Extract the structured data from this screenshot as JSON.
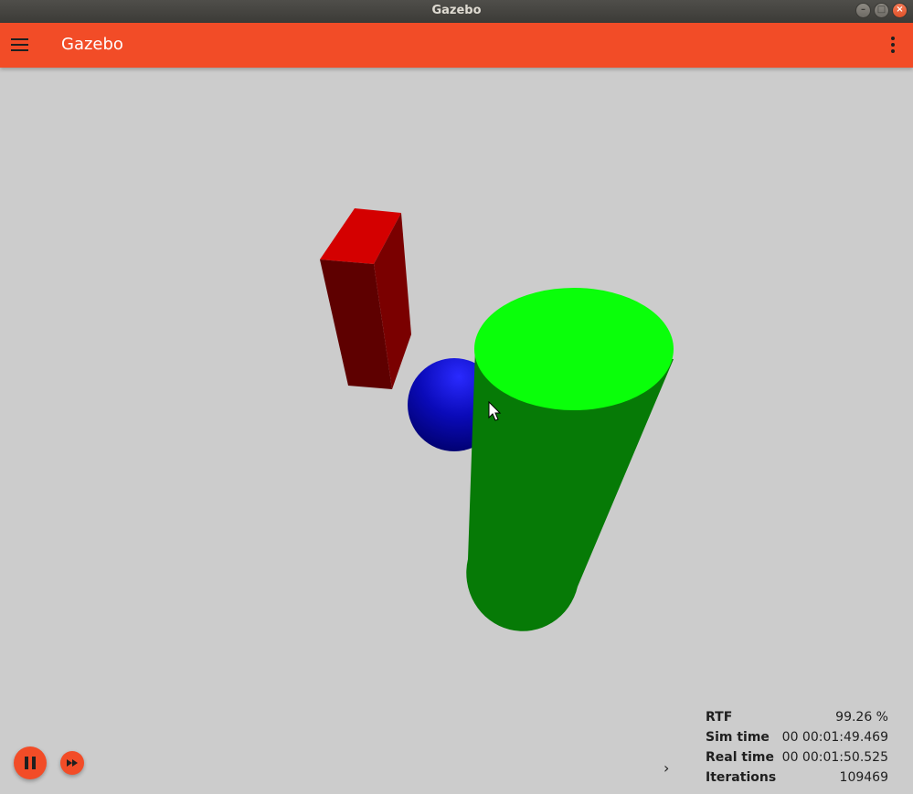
{
  "window": {
    "title": "Gazebo",
    "controls": [
      "minimize",
      "maximize",
      "close"
    ]
  },
  "appbar": {
    "title": "Gazebo",
    "menu_icon": "hamburger-menu-icon",
    "overflow_icon": "kebab-menu-icon",
    "color": "#f24c27"
  },
  "scene": {
    "background": "#cccccc",
    "objects": [
      {
        "name": "box",
        "color": "#cc0000"
      },
      {
        "name": "sphere",
        "color": "#0000cc"
      },
      {
        "name": "cylinder",
        "color": "#00cc00"
      }
    ]
  },
  "playback": {
    "pause_icon": "pause-icon",
    "step_icon": "fast-forward-icon",
    "expand_icon": "chevron-right-icon",
    "expand_glyph": "›"
  },
  "stats": {
    "rtf": {
      "label": "RTF",
      "value": "99.26 %"
    },
    "sim_time": {
      "label": "Sim time",
      "value": "00 00:01:49.469"
    },
    "real_time": {
      "label": "Real time",
      "value": "00 00:01:50.525"
    },
    "iterations": {
      "label": "Iterations",
      "value": "109469"
    }
  }
}
